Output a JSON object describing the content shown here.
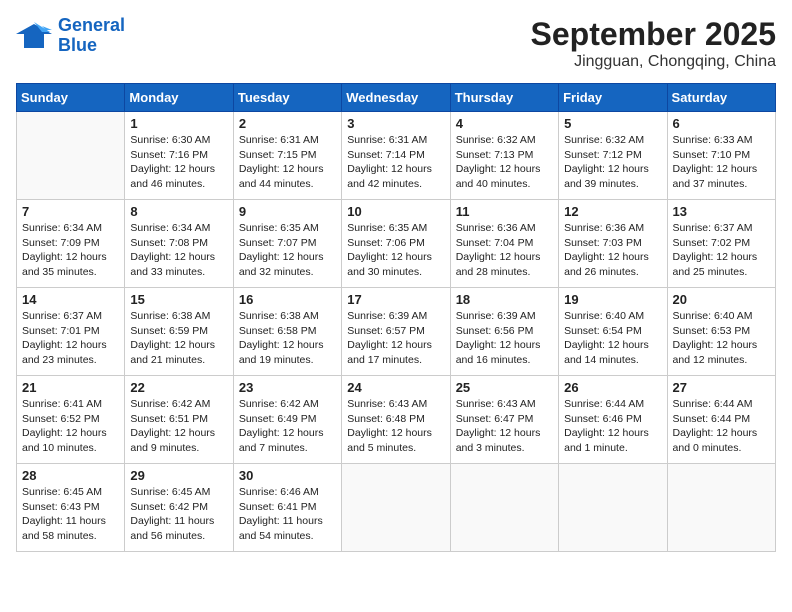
{
  "header": {
    "logo_line1": "General",
    "logo_line2": "Blue",
    "month": "September 2025",
    "location": "Jingguan, Chongqing, China"
  },
  "days_of_week": [
    "Sunday",
    "Monday",
    "Tuesday",
    "Wednesday",
    "Thursday",
    "Friday",
    "Saturday"
  ],
  "weeks": [
    [
      {
        "num": "",
        "info": ""
      },
      {
        "num": "1",
        "info": "Sunrise: 6:30 AM\nSunset: 7:16 PM\nDaylight: 12 hours\nand 46 minutes."
      },
      {
        "num": "2",
        "info": "Sunrise: 6:31 AM\nSunset: 7:15 PM\nDaylight: 12 hours\nand 44 minutes."
      },
      {
        "num": "3",
        "info": "Sunrise: 6:31 AM\nSunset: 7:14 PM\nDaylight: 12 hours\nand 42 minutes."
      },
      {
        "num": "4",
        "info": "Sunrise: 6:32 AM\nSunset: 7:13 PM\nDaylight: 12 hours\nand 40 minutes."
      },
      {
        "num": "5",
        "info": "Sunrise: 6:32 AM\nSunset: 7:12 PM\nDaylight: 12 hours\nand 39 minutes."
      },
      {
        "num": "6",
        "info": "Sunrise: 6:33 AM\nSunset: 7:10 PM\nDaylight: 12 hours\nand 37 minutes."
      }
    ],
    [
      {
        "num": "7",
        "info": "Sunrise: 6:34 AM\nSunset: 7:09 PM\nDaylight: 12 hours\nand 35 minutes."
      },
      {
        "num": "8",
        "info": "Sunrise: 6:34 AM\nSunset: 7:08 PM\nDaylight: 12 hours\nand 33 minutes."
      },
      {
        "num": "9",
        "info": "Sunrise: 6:35 AM\nSunset: 7:07 PM\nDaylight: 12 hours\nand 32 minutes."
      },
      {
        "num": "10",
        "info": "Sunrise: 6:35 AM\nSunset: 7:06 PM\nDaylight: 12 hours\nand 30 minutes."
      },
      {
        "num": "11",
        "info": "Sunrise: 6:36 AM\nSunset: 7:04 PM\nDaylight: 12 hours\nand 28 minutes."
      },
      {
        "num": "12",
        "info": "Sunrise: 6:36 AM\nSunset: 7:03 PM\nDaylight: 12 hours\nand 26 minutes."
      },
      {
        "num": "13",
        "info": "Sunrise: 6:37 AM\nSunset: 7:02 PM\nDaylight: 12 hours\nand 25 minutes."
      }
    ],
    [
      {
        "num": "14",
        "info": "Sunrise: 6:37 AM\nSunset: 7:01 PM\nDaylight: 12 hours\nand 23 minutes."
      },
      {
        "num": "15",
        "info": "Sunrise: 6:38 AM\nSunset: 6:59 PM\nDaylight: 12 hours\nand 21 minutes."
      },
      {
        "num": "16",
        "info": "Sunrise: 6:38 AM\nSunset: 6:58 PM\nDaylight: 12 hours\nand 19 minutes."
      },
      {
        "num": "17",
        "info": "Sunrise: 6:39 AM\nSunset: 6:57 PM\nDaylight: 12 hours\nand 17 minutes."
      },
      {
        "num": "18",
        "info": "Sunrise: 6:39 AM\nSunset: 6:56 PM\nDaylight: 12 hours\nand 16 minutes."
      },
      {
        "num": "19",
        "info": "Sunrise: 6:40 AM\nSunset: 6:54 PM\nDaylight: 12 hours\nand 14 minutes."
      },
      {
        "num": "20",
        "info": "Sunrise: 6:40 AM\nSunset: 6:53 PM\nDaylight: 12 hours\nand 12 minutes."
      }
    ],
    [
      {
        "num": "21",
        "info": "Sunrise: 6:41 AM\nSunset: 6:52 PM\nDaylight: 12 hours\nand 10 minutes."
      },
      {
        "num": "22",
        "info": "Sunrise: 6:42 AM\nSunset: 6:51 PM\nDaylight: 12 hours\nand 9 minutes."
      },
      {
        "num": "23",
        "info": "Sunrise: 6:42 AM\nSunset: 6:49 PM\nDaylight: 12 hours\nand 7 minutes."
      },
      {
        "num": "24",
        "info": "Sunrise: 6:43 AM\nSunset: 6:48 PM\nDaylight: 12 hours\nand 5 minutes."
      },
      {
        "num": "25",
        "info": "Sunrise: 6:43 AM\nSunset: 6:47 PM\nDaylight: 12 hours\nand 3 minutes."
      },
      {
        "num": "26",
        "info": "Sunrise: 6:44 AM\nSunset: 6:46 PM\nDaylight: 12 hours\nand 1 minute."
      },
      {
        "num": "27",
        "info": "Sunrise: 6:44 AM\nSunset: 6:44 PM\nDaylight: 12 hours\nand 0 minutes."
      }
    ],
    [
      {
        "num": "28",
        "info": "Sunrise: 6:45 AM\nSunset: 6:43 PM\nDaylight: 11 hours\nand 58 minutes."
      },
      {
        "num": "29",
        "info": "Sunrise: 6:45 AM\nSunset: 6:42 PM\nDaylight: 11 hours\nand 56 minutes."
      },
      {
        "num": "30",
        "info": "Sunrise: 6:46 AM\nSunset: 6:41 PM\nDaylight: 11 hours\nand 54 minutes."
      },
      {
        "num": "",
        "info": ""
      },
      {
        "num": "",
        "info": ""
      },
      {
        "num": "",
        "info": ""
      },
      {
        "num": "",
        "info": ""
      }
    ]
  ]
}
